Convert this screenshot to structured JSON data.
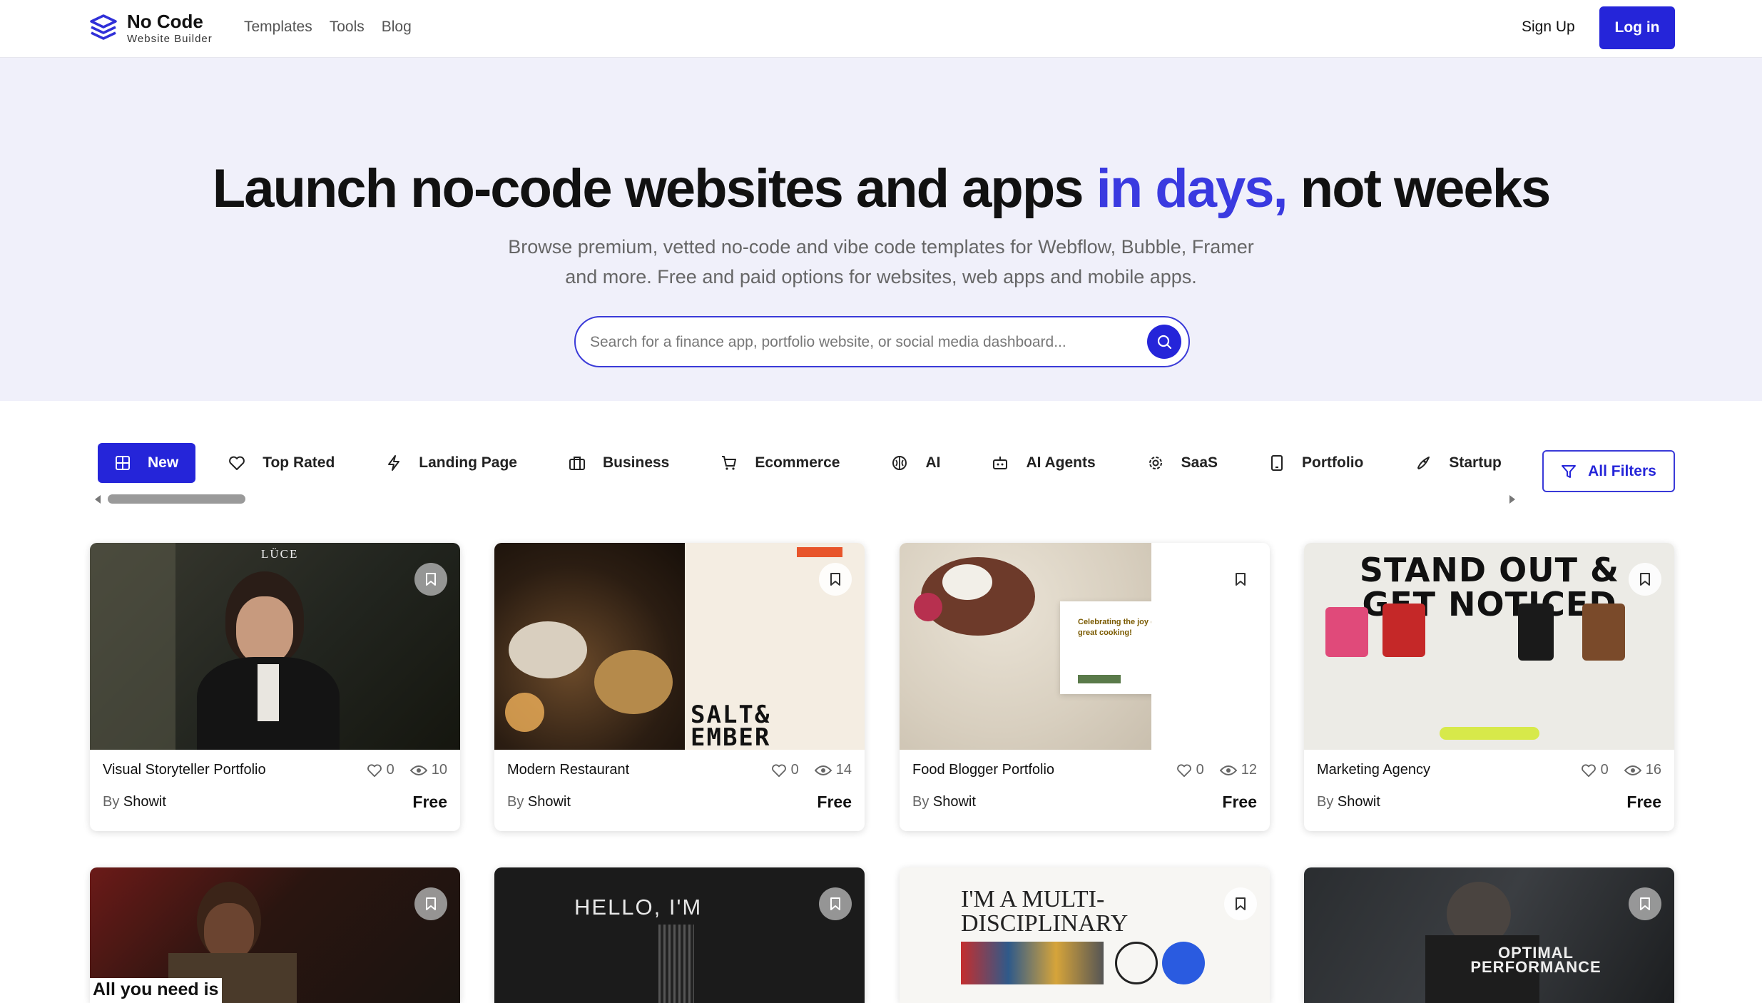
{
  "nav": {
    "logo_title": "No Code",
    "logo_subtitle": "Website Builder",
    "links": [
      "Templates",
      "Tools",
      "Blog"
    ],
    "signup": "Sign Up",
    "login": "Log in"
  },
  "hero": {
    "title_pre": "Launch no-code websites and apps ",
    "title_accent": "in days,",
    "title_post": " not weeks",
    "subtitle_line1": "Browse premium, vetted no-code and vibe code templates for Webflow, Bubble, Framer",
    "subtitle_line2": "and more. Free and paid options for websites, web apps and mobile apps.",
    "search_placeholder": "Search for a finance app, portfolio website, or social media dashboard..."
  },
  "filters": {
    "chips": [
      {
        "label": "New",
        "icon": "grid-icon",
        "active": true
      },
      {
        "label": "Top Rated",
        "icon": "heart-icon"
      },
      {
        "label": "Landing Page",
        "icon": "lightning-icon"
      },
      {
        "label": "Business",
        "icon": "briefcase-icon"
      },
      {
        "label": "Ecommerce",
        "icon": "cart-icon"
      },
      {
        "label": "AI",
        "icon": "brain-icon"
      },
      {
        "label": "AI Agents",
        "icon": "robot-icon"
      },
      {
        "label": "SaaS",
        "icon": "gear-icon"
      },
      {
        "label": "Portfolio",
        "icon": "tablet-icon"
      },
      {
        "label": "Startup",
        "icon": "rocket-icon"
      }
    ],
    "all_filters": "All Filters"
  },
  "cards": [
    {
      "title": "Visual Storyteller Portfolio",
      "likes": "0",
      "views": "10",
      "by": "By",
      "author": "Showit",
      "price": "Free",
      "thumb_text": "LÜCE"
    },
    {
      "title": "Modern Restaurant",
      "likes": "0",
      "views": "14",
      "by": "By",
      "author": "Showit",
      "price": "Free",
      "thumb_text": "SALT&\nEMBER"
    },
    {
      "title": "Food Blogger Portfolio",
      "likes": "0",
      "views": "12",
      "by": "By",
      "author": "Showit",
      "price": "Free",
      "thumb_text": "Celebrating the joy of great cooking!"
    },
    {
      "title": "Marketing Agency",
      "likes": "0",
      "views": "16",
      "by": "By",
      "author": "Showit",
      "price": "Free",
      "thumb_text": "STAND OUT & GET NOTICED"
    },
    {
      "thumb_text": "All you need is"
    },
    {
      "thumb_text": "HELLO, I'M"
    },
    {
      "thumb_text": "I'M A MULTI-DISCIPLINARY"
    },
    {
      "thumb_text": "OPTIMAL PERFORMANCE"
    }
  ],
  "colors": {
    "accent": "#2525d9",
    "hero_bg": "#f0f0fa"
  }
}
